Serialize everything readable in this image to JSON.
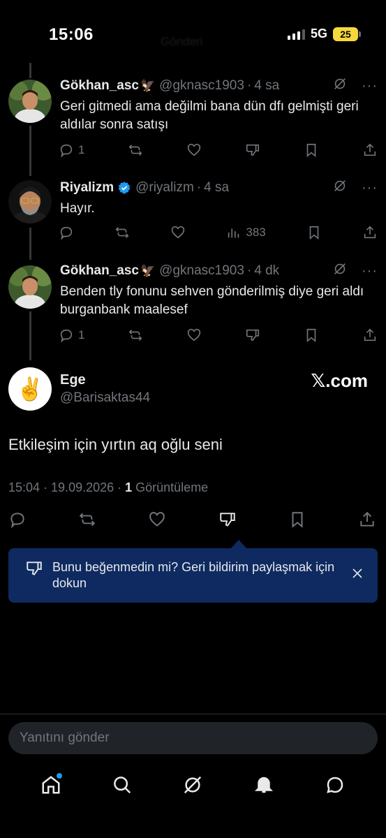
{
  "status_bar": {
    "time": "15:06",
    "network": "5G",
    "battery": "25",
    "ghost_title": "Gönderi"
  },
  "thread": [
    {
      "name": "Gökhan_asc",
      "name_emoji": "🦅",
      "handle": "@gknasc1903",
      "time": "4 sa",
      "text": "Geri gitmedi ama değilmi bana dün dfı gelmişti geri aldılar sonra satışı",
      "reply_count": "1",
      "type": "dislike"
    },
    {
      "name": "Riyalizm",
      "verified": true,
      "handle": "@riyalizm",
      "time": "4 sa",
      "text": "Hayır.",
      "views": "383",
      "type": "views"
    },
    {
      "name": "Gökhan_asc",
      "name_emoji": "🦅",
      "handle": "@gknasc1903",
      "time": "4 dk",
      "text": "Benden tly fonunu sehven gönderilmiş diye geri aldı burganbank maalesef",
      "reply_count": "1",
      "type": "dislike"
    }
  ],
  "main_tweet": {
    "name": "Ege",
    "handle": "@Barisaktas44",
    "avatar_emoji": "✌️",
    "watermark": "𝕏.com",
    "text": "Etkileşim için yırtın aq oğlu seni",
    "timestamp": "15:04 · 19.09.2026 · ",
    "views_count": "1",
    "views_label": " Görüntüleme"
  },
  "feedback_banner": {
    "text": "Bunu beğenmedin mi? Geri bildirim paylaşmak için dokun"
  },
  "reply": {
    "placeholder": "Yanıtını gönder"
  },
  "bottom_nav": [
    "home-icon",
    "search-icon",
    "grok-icon",
    "notifications-icon",
    "messages-icon"
  ],
  "colors": {
    "background": "#000000",
    "muted": "#71767b",
    "accent": "#1d9bf0",
    "banner": "#0e2a60",
    "battery": "#f5d93b"
  }
}
